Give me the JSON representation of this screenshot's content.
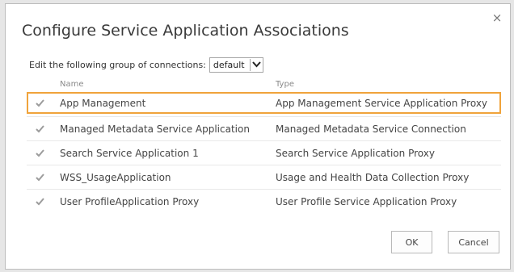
{
  "dialog": {
    "title": "Configure Service Application Associations",
    "close_glyph": "×"
  },
  "group": {
    "label": "Edit the following group of connections:",
    "selected": "default"
  },
  "table": {
    "headers": {
      "name": "Name",
      "type": "Type"
    },
    "rows": [
      {
        "name": "App Management",
        "type": "App Management Service Application Proxy",
        "checked": true,
        "selected": true
      },
      {
        "name": "Managed Metadata Service Application",
        "type": "Managed Metadata Service Connection",
        "checked": true,
        "selected": false
      },
      {
        "name": "Search Service Application 1",
        "type": "Search Service Application Proxy",
        "checked": true,
        "selected": false
      },
      {
        "name": "WSS_UsageApplication",
        "type": "Usage and Health Data Collection Proxy",
        "checked": true,
        "selected": false
      },
      {
        "name": "User ProfileApplication Proxy",
        "type": "User Profile Service Application Proxy",
        "checked": true,
        "selected": false
      }
    ]
  },
  "buttons": {
    "ok": "OK",
    "cancel": "Cancel"
  },
  "colors": {
    "selection_border": "#f0a33b",
    "checkbox": "#9c9c9c"
  },
  "icons": {
    "checkbox": "checkmark-icon",
    "dropdown": "chevron-down-icon",
    "close": "close-icon"
  }
}
